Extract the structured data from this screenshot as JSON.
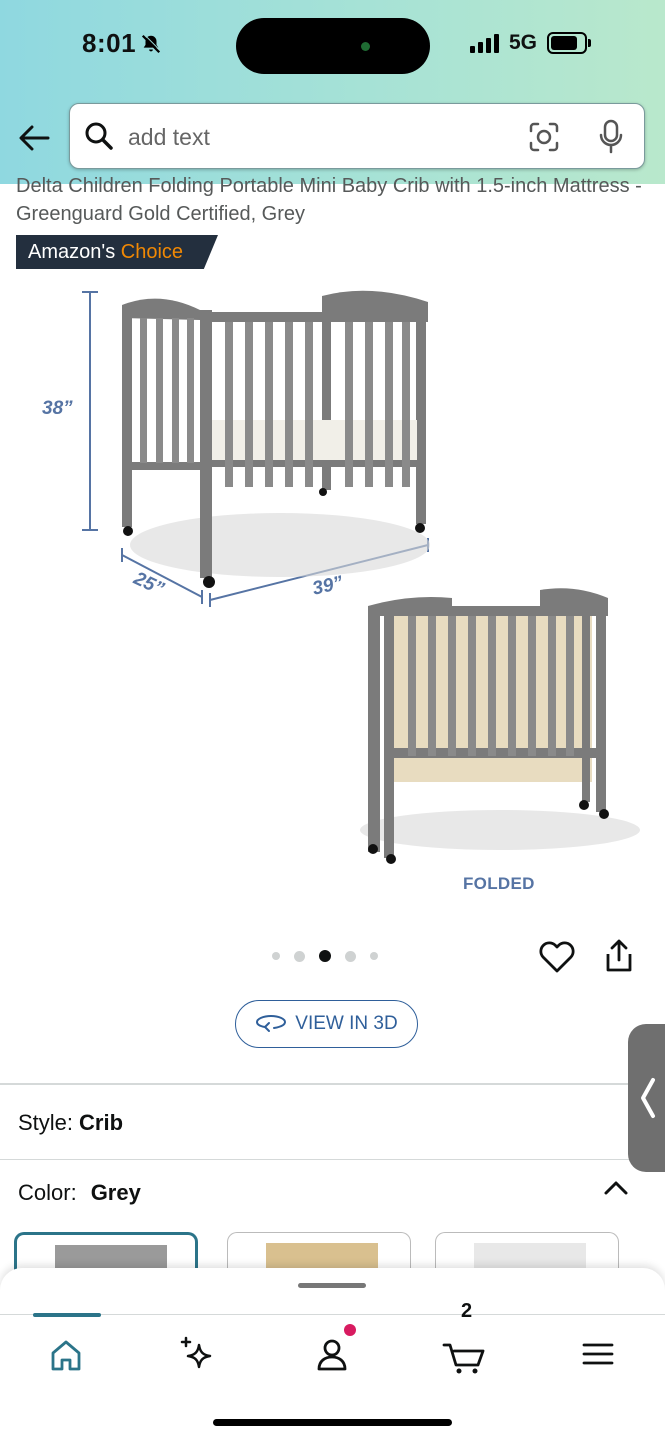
{
  "status": {
    "time": "8:01",
    "network": "5G"
  },
  "search": {
    "placeholder": "add text"
  },
  "product": {
    "title": "Delta Children Folding Portable Mini Baby Crib with 1.5-inch Mattress - Greenguard Gold Certified, Grey",
    "badge_part1": "Amazon's",
    "badge_part2": "Choice",
    "dim_height": "38”",
    "dim_depth": "25”",
    "dim_width": "39”",
    "folded_label": "FOLDED"
  },
  "gallery": {
    "image_count": 5,
    "active_index": 2
  },
  "view3d": {
    "label": "VIEW IN 3D"
  },
  "style": {
    "label": "Style:",
    "value": "Crib"
  },
  "color": {
    "label": "Color:",
    "value": "Grey"
  },
  "swatches": [
    {
      "color": "#9a9a9a",
      "selected": true
    },
    {
      "color": "#d9c08f",
      "selected": false
    },
    {
      "color": "#e6e6e6",
      "selected": false
    }
  ],
  "nav": {
    "items": [
      "home-icon",
      "ai-sparkle-icon",
      "account-icon",
      "cart-icon",
      "menu-icon"
    ],
    "cart_count": "2"
  },
  "colors": {
    "accent": "#2b7489",
    "badge_bg": "#232f3e",
    "choice_orange": "#f08804",
    "link_blue": "#2f5f9a"
  }
}
